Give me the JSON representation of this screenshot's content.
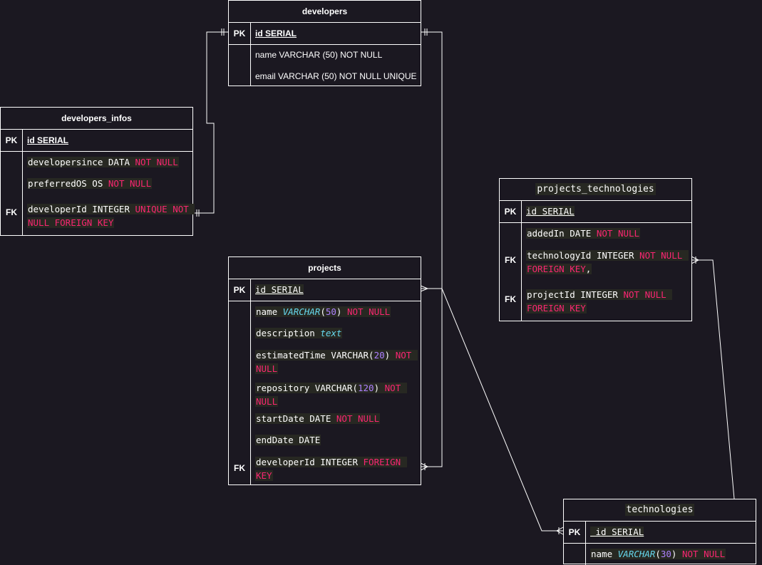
{
  "tables": {
    "developers": {
      "title": "developers",
      "pk_key": "PK",
      "pk": "id SERIAL",
      "fields": [
        "name VARCHAR (50) NOT NULL",
        "email VARCHAR (50) NOT NULL UNIQUE"
      ]
    },
    "developers_infos": {
      "title": "developers_infos",
      "pk_key": "PK",
      "pk": "id SERIAL",
      "fk_key": "FK",
      "f1_name": "developersince DATA ",
      "f1_mod": "NOT NULL",
      "f2_name": "preferredOS OS ",
      "f2_mod": "NOT NULL",
      "f3_name": "developerId INTEGER ",
      "f3_mod": "UNIQUE NOT NULL FOREIGN KEY"
    },
    "projects": {
      "title": "projects",
      "pk_key": "PK",
      "pk": "id SERIAL",
      "fk_key": "FK",
      "name_a": "name ",
      "name_type": "VARCHAR",
      "name_paren1": "(",
      "name_num": "50",
      "name_paren2": ") ",
      "name_mod": "NOT NULL",
      "desc_a": "description ",
      "desc_type": "text",
      "est_a": "estimatedTime VARCHAR(",
      "est_num": "20",
      "est_b": ") ",
      "est_mod": "NOT NULL",
      "repo_a": "repository VARCHAR(",
      "repo_num": "120",
      "repo_b": ") ",
      "repo_mod": "NOT NULL",
      "start_a": "startDate DATE ",
      "start_mod": "NOT NULL",
      "end_a": "endDate DATE",
      "dev_a": "developerId INTEGER ",
      "dev_mod": "FOREIGN KEY"
    },
    "projects_technologies": {
      "title": "projects_technologies",
      "pk_key": "PK",
      "pk": "id SERIAL",
      "fk_key": "FK",
      "added_a": "addedIn DATE ",
      "added_mod": "NOT NULL",
      "tech_a": "technologyId INTEGER ",
      "tech_mod": "NOT NULL FOREIGN KEY",
      "tech_b": ",",
      "proj_a": "projectId INTEGER ",
      "proj_mod": "NOT NULL FOREIGN KEY"
    },
    "technologies": {
      "title": "technologies",
      "pk_key": "PK",
      "pk": " id SERIAL",
      "name_a": "name ",
      "name_type": "VARCHAR",
      "name_paren1": "(",
      "name_num": "30",
      "name_paren2": ") ",
      "name_mod": "NOT NULL"
    }
  }
}
